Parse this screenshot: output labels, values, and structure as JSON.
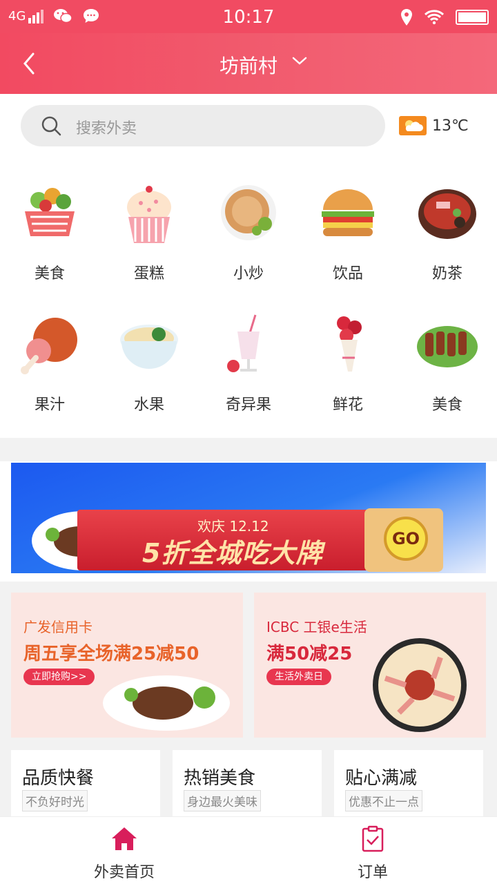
{
  "status_bar": {
    "network": "4G",
    "time": "10:17"
  },
  "header": {
    "title": "坊前村"
  },
  "search": {
    "placeholder": "搜索外卖"
  },
  "weather": {
    "temp": "13℃",
    "icon": "partly-cloudy-icon"
  },
  "categories": [
    {
      "label": "美食",
      "icon": "vegetable-basket-icon"
    },
    {
      "label": "蛋糕",
      "icon": "cupcake-icon"
    },
    {
      "label": "小炒",
      "icon": "pancake-icon"
    },
    {
      "label": "饮品",
      "icon": "burger-icon"
    },
    {
      "label": "奶茶",
      "icon": "hotpot-icon"
    },
    {
      "label": "果汁",
      "icon": "drumstick-icon"
    },
    {
      "label": "水果",
      "icon": "noodle-bowl-icon"
    },
    {
      "label": "奇异果",
      "icon": "smoothie-icon"
    },
    {
      "label": "鲜花",
      "icon": "flower-bouquet-icon"
    },
    {
      "label": "美食",
      "icon": "skewers-icon"
    }
  ],
  "banner": {
    "date": "欢庆 12.12",
    "slogan": "5折全城吃大牌",
    "go": "GO"
  },
  "promos": [
    {
      "bank": "广发信用卡",
      "offer": "周五享全场满25减50",
      "button": "立即抢购>>",
      "bank_color": "#e8632a",
      "offer_color": "#e8632a"
    },
    {
      "bank": "ICBC 工银e生活",
      "offer": "满50减25",
      "button": "生活外卖日",
      "bank_color": "#d8283c",
      "offer_color": "#d8283c"
    }
  ],
  "features": [
    {
      "title": "品质快餐",
      "subtitle": "不负好时光"
    },
    {
      "title": "热销美食",
      "subtitle": "身边最火美味"
    },
    {
      "title": "贴心满减",
      "subtitle": "优惠不止一点"
    }
  ],
  "bottom_nav": [
    {
      "label": "外卖首页",
      "icon": "home-icon",
      "active": true
    },
    {
      "label": "订单",
      "icon": "clipboard-check-icon",
      "active": false
    }
  ],
  "colors": {
    "brand": "#f14b62",
    "active_nav": "#d81e5b"
  }
}
